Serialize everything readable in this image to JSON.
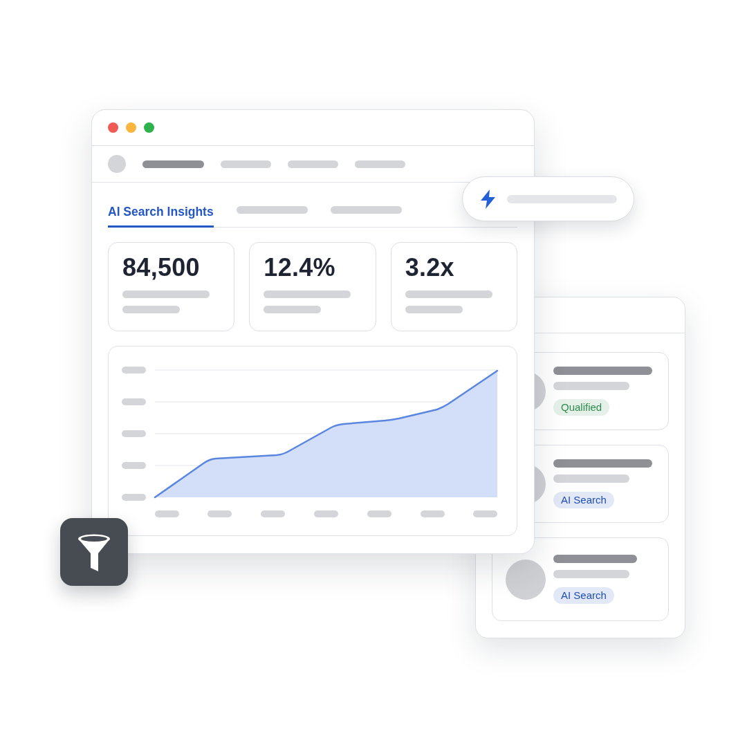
{
  "window": {
    "nav": [
      {
        "selected": true
      },
      {
        "selected": false
      },
      {
        "selected": false
      },
      {
        "selected": false
      }
    ],
    "tabs": [
      {
        "label": "AI Search Insights",
        "selected": true
      },
      {
        "selected": false
      },
      {
        "selected": false
      }
    ],
    "stats": [
      {
        "value": "84,500"
      },
      {
        "value": "12.4%"
      },
      {
        "value": "3.2x"
      }
    ]
  },
  "leads": [
    {
      "tag": "Qualified",
      "color": "#2e8a4e"
    },
    {
      "tag": "AI Search",
      "color": "#1f4fb5"
    },
    {
      "tag": "AI Search",
      "color": "#1f4fb5"
    }
  ]
}
